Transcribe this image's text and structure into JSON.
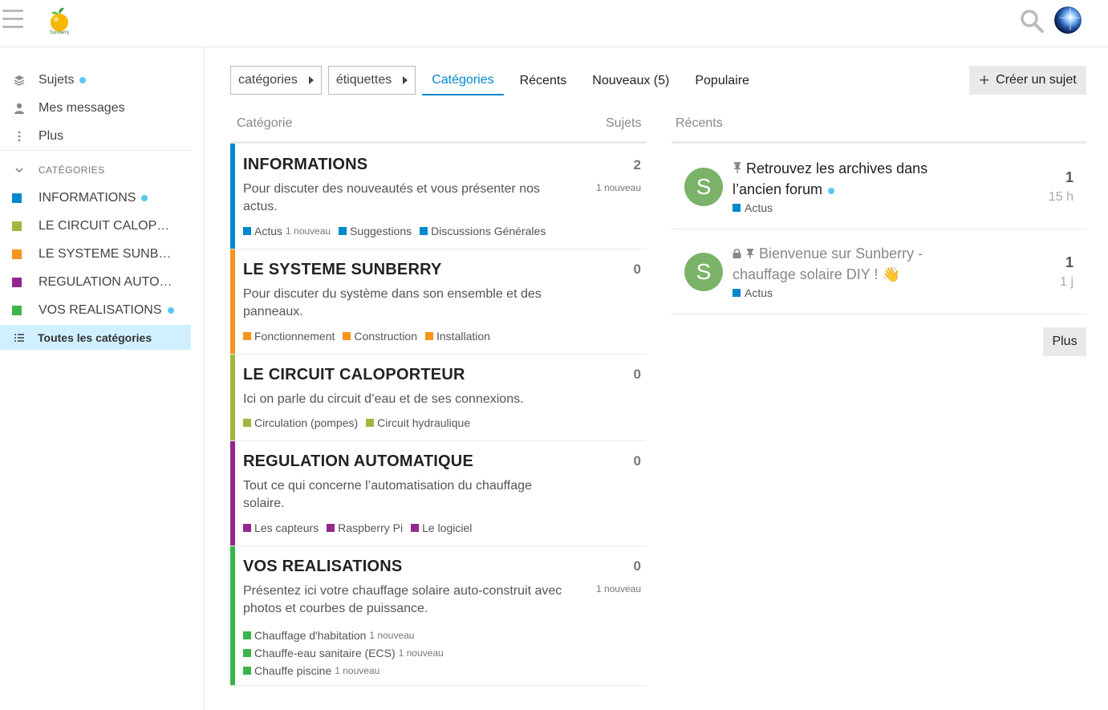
{
  "header": {
    "logo_text": "Sunberry"
  },
  "sidebar": {
    "topics": "Sujets",
    "messages": "Mes messages",
    "more": "Plus",
    "section": "CATÉGORIES",
    "categories": [
      {
        "label": "INFORMATIONS",
        "color": "#0088cc",
        "dot": true
      },
      {
        "label": "LE CIRCUIT CALOPORTEUR",
        "color": "#9eb83b",
        "dot": false
      },
      {
        "label": "LE SYSTEME SUNBERRY",
        "color": "#f7941d",
        "dot": false
      },
      {
        "label": "REGULATION AUTOMATIQUE",
        "color": "#92278f",
        "dot": false
      },
      {
        "label": "VOS REALISATIONS",
        "color": "#3ab54a",
        "dot": true
      }
    ],
    "all": "Toutes les catégories"
  },
  "nav": {
    "categories_dropdown": "catégories",
    "tags_dropdown": "étiquettes",
    "tabs": [
      "Catégories",
      "Récents",
      "Nouveaux (5)",
      "Populaire"
    ],
    "create": "Créer un sujet"
  },
  "table": {
    "col_category": "Catégorie",
    "col_topics": "Sujets",
    "col_recent": "Récents"
  },
  "categories": [
    {
      "name": "INFORMATIONS",
      "color": "#0088cc",
      "desc": "Pour discuter des nouveautés et vous présenter nos actus.",
      "count": "2",
      "new": "1 nouveau",
      "subs": [
        {
          "label": "Actus",
          "new": "1 nouveau"
        },
        {
          "label": "Suggestions",
          "new": ""
        },
        {
          "label": "Discussions Générales",
          "new": ""
        }
      ]
    },
    {
      "name": "LE SYSTEME SUNBERRY",
      "color": "#f7941d",
      "desc": "Pour discuter du système dans son ensemble et des panneaux.",
      "count": "0",
      "new": "",
      "subs": [
        {
          "label": "Fonctionnement",
          "new": ""
        },
        {
          "label": "Construction",
          "new": ""
        },
        {
          "label": "Installation",
          "new": ""
        }
      ]
    },
    {
      "name": "LE CIRCUIT CALOPORTEUR",
      "color": "#9eb83b",
      "desc": "Ici on parle du circuit d’eau et de ses connexions.",
      "count": "0",
      "new": "",
      "subs": [
        {
          "label": "Circulation (pompes)",
          "new": ""
        },
        {
          "label": "Circuit hydraulique",
          "new": ""
        }
      ]
    },
    {
      "name": "REGULATION AUTOMATIQUE",
      "color": "#92278f",
      "desc": "Tout ce qui concerne l’automatisation du chauffage solaire.",
      "count": "0",
      "new": "",
      "subs": [
        {
          "label": "Les capteurs",
          "new": ""
        },
        {
          "label": "Raspberry Pi",
          "new": ""
        },
        {
          "label": "Le logiciel",
          "new": ""
        }
      ]
    },
    {
      "name": "VOS REALISATIONS",
      "color": "#3ab54a",
      "desc": "Présentez ici votre chauffage solaire auto-construit avec photos et courbes de puissance.",
      "count": "0",
      "new": "1 nouveau",
      "subs": [
        {
          "label": "Chauffage d'habitation",
          "new": "1 nouveau"
        },
        {
          "label": "Chauffe-eau sanitaire (ECS)",
          "new": "1 nouveau"
        },
        {
          "label": "Chauffe piscine",
          "new": "1 nouveau"
        }
      ]
    }
  ],
  "recent": [
    {
      "avatar": "S",
      "title": "Retrouvez les archives dans l’ancien forum",
      "tag": "Actus",
      "replies": "1",
      "age": "15 h"
    },
    {
      "avatar": "S",
      "title": "Bienvenue sur Sunberry - chauffage solaire DIY ! 👋",
      "tag": "Actus",
      "replies": "1",
      "age": "1 j"
    }
  ],
  "more_button": "Plus"
}
